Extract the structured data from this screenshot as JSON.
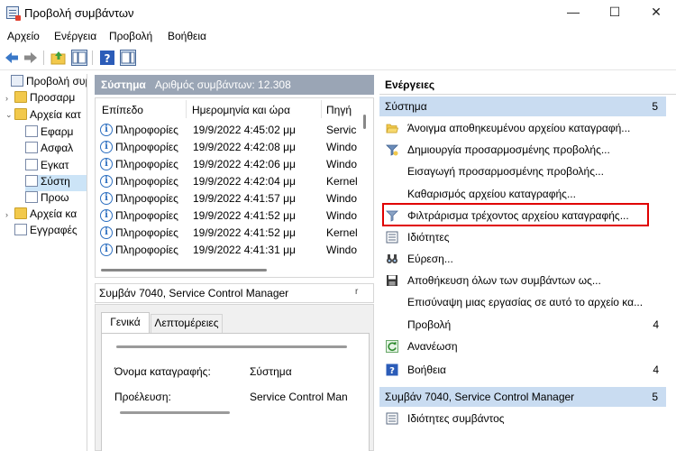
{
  "window": {
    "title": "Προβολή συμβάντων",
    "icon": "event-viewer-icon",
    "controls": {
      "minimize": "—",
      "maximize": "☐",
      "close": "✕"
    }
  },
  "menu": [
    "Αρχείο",
    "Ενέργεια",
    "Προβολή",
    "Βοήθεια"
  ],
  "toolbar": [
    "back-arrow-icon",
    "forward-arrow-icon",
    "up-folder-icon",
    "show-hide-tree-icon",
    "help-icon",
    "show-hide-action-pane-icon"
  ],
  "tree": {
    "items": [
      {
        "label": "Προβολή συμ",
        "expander": "",
        "icon": "event-viewer-icon"
      },
      {
        "label": "Προσαρμ",
        "expander": "›",
        "icon": "folder-icon"
      },
      {
        "label": "Αρχεία κατ",
        "expander": "⌄",
        "icon": "folder-icon"
      },
      {
        "label": "Εφαρμ",
        "expander": "",
        "icon": "log-icon"
      },
      {
        "label": "Ασφαλ",
        "expander": "",
        "icon": "log-icon"
      },
      {
        "label": "Εγκατ",
        "expander": "",
        "icon": "log-icon"
      },
      {
        "label": "Σύστη",
        "expander": "",
        "icon": "log-icon"
      },
      {
        "label": "Προω",
        "expander": "",
        "icon": "log-icon"
      },
      {
        "label": "Αρχεία κα",
        "expander": "›",
        "icon": "folder-icon"
      },
      {
        "label": "Εγγραφές",
        "expander": "",
        "icon": "subscriptions-icon"
      }
    ],
    "selected_index": 6
  },
  "log_header": {
    "name": "Σύστημα",
    "count_text": "Αριθμός συμβάντων: 12.308"
  },
  "grid": {
    "columns": [
      "Επίπεδο",
      "Ημερομηνία και ώρα",
      "Πηγή"
    ],
    "rows": [
      {
        "level": "Πληροφορίες",
        "datetime": "19/9/2022 4:45:02 μμ",
        "source": "Servic"
      },
      {
        "level": "Πληροφορίες",
        "datetime": "19/9/2022 4:42:08 μμ",
        "source": "Windo"
      },
      {
        "level": "Πληροφορίες",
        "datetime": "19/9/2022 4:42:06 μμ",
        "source": "Windo"
      },
      {
        "level": "Πληροφορίες",
        "datetime": "19/9/2022 4:42:04 μμ",
        "source": "Kernel"
      },
      {
        "level": "Πληροφορίες",
        "datetime": "19/9/2022 4:41:57 μμ",
        "source": "Windo"
      },
      {
        "level": "Πληροφορίες",
        "datetime": "19/9/2022 4:41:52 μμ",
        "source": "Windo"
      },
      {
        "level": "Πληροφορίες",
        "datetime": "19/9/2022 4:41:52 μμ",
        "source": "Kernel"
      },
      {
        "level": "Πληροφορίες",
        "datetime": "19/9/2022 4:41:31 μμ",
        "source": "Windo"
      }
    ]
  },
  "detail": {
    "title": "Συμβάν 7040, Service Control Manager",
    "close_glyph": "r",
    "tabs": [
      "Γενικά",
      "Λεπτομέρειες"
    ],
    "fields": [
      {
        "label": "Όνομα καταγραφής:",
        "value": "Σύστημα"
      },
      {
        "label": "Προέλευση:",
        "value": "Service Control Man"
      }
    ]
  },
  "actions": {
    "header": "Ενέργειες",
    "section1": {
      "title": "Σύστημα",
      "count": "5"
    },
    "items": [
      {
        "label": "Άνοιγμα αποθηκευμένου αρχείου καταγραφή...",
        "icon": "open-folder-icon",
        "count": ""
      },
      {
        "label": "Δημιουργία προσαρμοσμένης προβολής...",
        "icon": "filter-create-icon",
        "count": ""
      },
      {
        "label": "Εισαγωγή προσαρμοσμένης προβολής...",
        "icon": "",
        "count": ""
      },
      {
        "label": "Καθαρισμός αρχείου καταγραφής...",
        "icon": "",
        "count": ""
      },
      {
        "label": "Φιλτράρισμα τρέχοντος αρχείου καταγραφής...",
        "icon": "filter-icon",
        "count": ""
      },
      {
        "label": "Ιδιότητες",
        "icon": "properties-icon",
        "count": ""
      },
      {
        "label": "Εύρεση...",
        "icon": "binoculars-icon",
        "count": ""
      },
      {
        "label": "Αποθήκευση όλων των συμβάντων ως...",
        "icon": "save-icon",
        "count": ""
      },
      {
        "label": "Επισύναψη μιας εργασίας σε αυτό το αρχείο κα...",
        "icon": "",
        "count": ""
      },
      {
        "label": "Προβολή",
        "icon": "",
        "count": "4"
      },
      {
        "label": "Ανανέωση",
        "icon": "refresh-icon",
        "count": ""
      },
      {
        "label": "Βοήθεια",
        "icon": "help-icon",
        "count": "4"
      }
    ],
    "section2": {
      "title": "Συμβάν 7040, Service Control Manager",
      "count": "5"
    },
    "items2": [
      {
        "label": "Ιδιότητες συμβάντος",
        "icon": "properties-icon",
        "count": ""
      }
    ],
    "highlighted_index": 4,
    "highlight_color": "#e00000"
  },
  "colors": {
    "section_bg": "#c9dcf1",
    "log_header_bg": "#9aa5b5",
    "selection_bg": "#cce4f7",
    "info_icon": "#2d6fc0"
  }
}
